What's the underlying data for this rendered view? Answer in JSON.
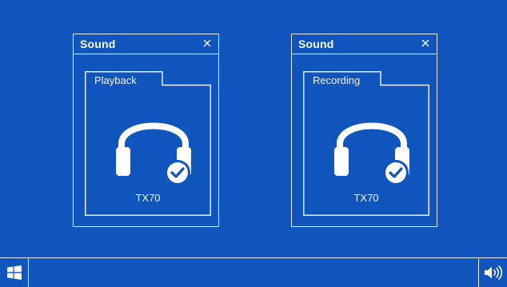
{
  "colors": {
    "background": "#0f55bd",
    "foreground": "#ffffff"
  },
  "windows": [
    {
      "title": "Sound",
      "close_icon": "close-icon",
      "tab": "Playback",
      "device": {
        "icon": "headphones-check-icon",
        "name": "TX70"
      }
    },
    {
      "title": "Sound",
      "close_icon": "close-icon",
      "tab": "Recording",
      "device": {
        "icon": "headphones-check-icon",
        "name": "TX70"
      }
    }
  ],
  "taskbar": {
    "start_icon": "windows-start-icon",
    "tray_icon": "volume-icon"
  }
}
